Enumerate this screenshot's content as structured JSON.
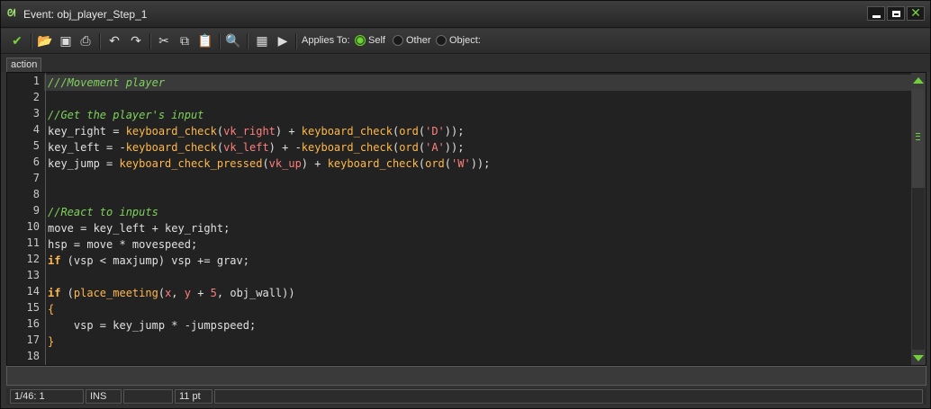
{
  "window": {
    "title": "Event: obj_player_Step_1",
    "icon": "gm-logo-icon"
  },
  "toolbar": {
    "applies_label": "Applies To:",
    "radios": [
      {
        "label": "Self",
        "selected": true
      },
      {
        "label": "Other",
        "selected": false
      },
      {
        "label": "Object:",
        "selected": false
      }
    ]
  },
  "tab": {
    "label": "action"
  },
  "editor": {
    "line_numbers": [
      "1",
      "2",
      "3",
      "4",
      "5",
      "6",
      "7",
      "8",
      "9",
      "10",
      "11",
      "12",
      "13",
      "14",
      "15",
      "16",
      "17",
      "18"
    ],
    "lines": [
      "///Movement player",
      "",
      "//Get the player's input",
      "key_right = keyboard_check(vk_right) + keyboard_check(ord('D'));",
      "key_left = -keyboard_check(vk_left) + -keyboard_check(ord('A'));",
      "key_jump = keyboard_check_pressed(vk_up) + keyboard_check(ord('W'));",
      "",
      "",
      "//React to inputs",
      "move = key_left + key_right;",
      "hsp = move * movespeed;",
      "if (vsp < maxjump) vsp += grav;",
      "",
      "if (place_meeting(x, y + 5, obj_wall))",
      "{",
      "    vsp = key_jump * -jumpspeed;",
      "}",
      ""
    ]
  },
  "status": {
    "position": "1/46: 1",
    "mode": "INS",
    "blank": "",
    "font_size": "11 pt"
  },
  "colors": {
    "comment": "#7fd35c",
    "function": "#ffb84a",
    "constant": "#ff7f7f",
    "accent": "#6fd13a"
  }
}
